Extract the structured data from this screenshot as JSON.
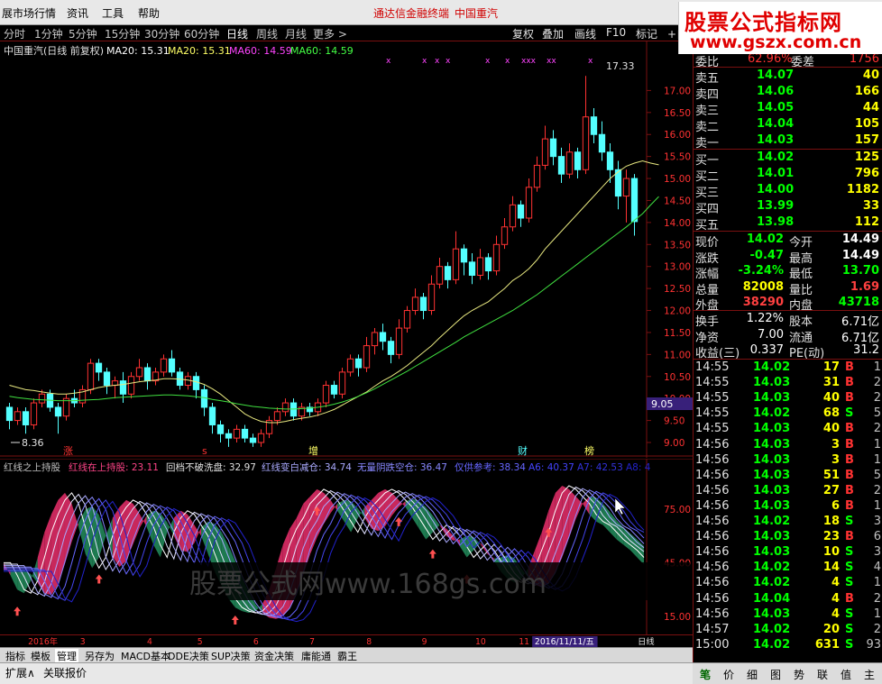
{
  "menubar": {
    "items": [
      "展市场行情",
      "资讯",
      "工具",
      "帮助"
    ],
    "center_title": "通达信金融终端",
    "center_stock": "中国重汽"
  },
  "logo": {
    "line1": "股票公式指标网",
    "line2": "www.gszx.com.cn"
  },
  "toolbar": {
    "periods": [
      "分时",
      "1分钟",
      "5分钟",
      "15分钟",
      "30分钟",
      "60分钟",
      "日线",
      "周线",
      "月线",
      "更多 >"
    ],
    "active_period": "日线",
    "right_buttons": [
      "复权",
      "叠加",
      "画线",
      "F10",
      "标记",
      "+自"
    ]
  },
  "main_chart": {
    "header_name": "中国重汽(日线 前复权)",
    "ma_items": [
      {
        "text": "MA20: 15.31",
        "color": "#ffffff"
      },
      {
        "text": "MA20: 15.31",
        "color": "#ffff66"
      },
      {
        "text": "MA60: 14.59",
        "color": "#ff44ff"
      },
      {
        "text": "MA60: 14.59",
        "color": "#44ff44"
      }
    ],
    "high_label": "17.33",
    "low_label": "8.36",
    "current_price_tag": "9.05",
    "event_marks": [
      "涨",
      "s",
      "增",
      "财",
      "榜"
    ],
    "x_marks": [
      "x",
      "x",
      "x",
      "x",
      "x",
      "x",
      "xxx",
      "xx",
      "x"
    ]
  },
  "chart_data": {
    "type": "candlestick",
    "y_ticks": [
      "17.00",
      "16.50",
      "16.00",
      "15.50",
      "15.00",
      "14.50",
      "14.00",
      "13.50",
      "13.00",
      "12.50",
      "12.00",
      "11.50",
      "11.00",
      "10.50",
      "10.00",
      "9.50",
      "9.00"
    ],
    "ylim": [
      9.0,
      17.5
    ],
    "candles": [
      {
        "o": 9.8,
        "c": 9.5,
        "h": 9.9,
        "l": 9.3
      },
      {
        "o": 9.5,
        "c": 9.7,
        "h": 9.8,
        "l": 9.4
      },
      {
        "o": 9.7,
        "c": 9.4,
        "h": 9.8,
        "l": 9.2
      },
      {
        "o": 9.4,
        "c": 9.9,
        "h": 10.0,
        "l": 9.3
      },
      {
        "o": 9.9,
        "c": 10.1,
        "h": 10.2,
        "l": 9.8
      },
      {
        "o": 10.1,
        "c": 9.8,
        "h": 10.2,
        "l": 9.7
      },
      {
        "o": 9.8,
        "c": 9.6,
        "h": 9.9,
        "l": 9.2
      },
      {
        "o": 9.6,
        "c": 10.0,
        "h": 10.1,
        "l": 9.5
      },
      {
        "o": 10.0,
        "c": 9.9,
        "h": 10.2,
        "l": 9.8
      },
      {
        "o": 9.9,
        "c": 10.2,
        "h": 10.3,
        "l": 9.8
      },
      {
        "o": 10.2,
        "c": 10.8,
        "h": 10.9,
        "l": 10.1
      },
      {
        "o": 10.8,
        "c": 10.6,
        "h": 10.9,
        "l": 10.4
      },
      {
        "o": 10.6,
        "c": 10.3,
        "h": 10.7,
        "l": 10.1
      },
      {
        "o": 10.3,
        "c": 10.4,
        "h": 10.5,
        "l": 10.0
      },
      {
        "o": 10.4,
        "c": 10.1,
        "h": 10.6,
        "l": 9.9
      },
      {
        "o": 10.1,
        "c": 10.5,
        "h": 10.6,
        "l": 10.0
      },
      {
        "o": 10.5,
        "c": 10.7,
        "h": 10.9,
        "l": 10.4
      },
      {
        "o": 10.7,
        "c": 10.4,
        "h": 10.8,
        "l": 10.2
      },
      {
        "o": 10.4,
        "c": 10.6,
        "h": 10.7,
        "l": 10.3
      },
      {
        "o": 10.6,
        "c": 10.9,
        "h": 11.0,
        "l": 10.5
      },
      {
        "o": 10.9,
        "c": 10.6,
        "h": 11.1,
        "l": 10.5
      },
      {
        "o": 10.6,
        "c": 10.3,
        "h": 10.7,
        "l": 10.2
      },
      {
        "o": 10.3,
        "c": 10.5,
        "h": 10.6,
        "l": 10.2
      },
      {
        "o": 10.5,
        "c": 10.2,
        "h": 10.6,
        "l": 10.0
      },
      {
        "o": 10.2,
        "c": 9.8,
        "h": 10.3,
        "l": 9.6
      },
      {
        "o": 9.8,
        "c": 9.4,
        "h": 9.9,
        "l": 9.2
      },
      {
        "o": 9.4,
        "c": 9.2,
        "h": 9.5,
        "l": 9.0
      },
      {
        "o": 9.2,
        "c": 9.1,
        "h": 9.3,
        "l": 8.9
      },
      {
        "o": 9.1,
        "c": 9.3,
        "h": 9.4,
        "l": 9.0
      },
      {
        "o": 9.3,
        "c": 9.1,
        "h": 9.4,
        "l": 9.0
      },
      {
        "o": 9.1,
        "c": 9.0,
        "h": 9.2,
        "l": 8.9
      },
      {
        "o": 9.0,
        "c": 9.2,
        "h": 9.3,
        "l": 8.9
      },
      {
        "o": 9.2,
        "c": 9.5,
        "h": 9.6,
        "l": 9.1
      },
      {
        "o": 9.5,
        "c": 9.7,
        "h": 9.8,
        "l": 9.4
      },
      {
        "o": 9.7,
        "c": 9.9,
        "h": 10.0,
        "l": 9.6
      },
      {
        "o": 9.9,
        "c": 9.6,
        "h": 10.0,
        "l": 9.5
      },
      {
        "o": 9.6,
        "c": 9.8,
        "h": 9.9,
        "l": 9.5
      },
      {
        "o": 9.8,
        "c": 9.7,
        "h": 9.9,
        "l": 9.6
      },
      {
        "o": 9.7,
        "c": 9.9,
        "h": 10.0,
        "l": 9.6
      },
      {
        "o": 9.9,
        "c": 10.3,
        "h": 10.4,
        "l": 9.8
      },
      {
        "o": 10.3,
        "c": 10.1,
        "h": 10.4,
        "l": 10.0
      },
      {
        "o": 10.1,
        "c": 10.6,
        "h": 10.7,
        "l": 10.0
      },
      {
        "o": 10.6,
        "c": 10.9,
        "h": 11.0,
        "l": 10.5
      },
      {
        "o": 10.9,
        "c": 10.7,
        "h": 11.0,
        "l": 10.5
      },
      {
        "o": 10.7,
        "c": 11.2,
        "h": 11.4,
        "l": 10.6
      },
      {
        "o": 11.2,
        "c": 11.5,
        "h": 11.6,
        "l": 11.0
      },
      {
        "o": 11.5,
        "c": 11.3,
        "h": 11.7,
        "l": 11.1
      },
      {
        "o": 11.3,
        "c": 11.0,
        "h": 11.4,
        "l": 10.8
      },
      {
        "o": 11.0,
        "c": 11.6,
        "h": 11.8,
        "l": 10.9
      },
      {
        "o": 11.6,
        "c": 12.0,
        "h": 12.1,
        "l": 11.5
      },
      {
        "o": 12.0,
        "c": 12.3,
        "h": 12.5,
        "l": 11.9
      },
      {
        "o": 12.3,
        "c": 12.0,
        "h": 12.4,
        "l": 11.8
      },
      {
        "o": 12.0,
        "c": 12.6,
        "h": 12.8,
        "l": 11.9
      },
      {
        "o": 12.6,
        "c": 13.0,
        "h": 13.2,
        "l": 12.5
      },
      {
        "o": 13.0,
        "c": 12.7,
        "h": 13.1,
        "l": 12.5
      },
      {
        "o": 12.7,
        "c": 13.4,
        "h": 13.8,
        "l": 12.6
      },
      {
        "o": 13.4,
        "c": 13.1,
        "h": 13.5,
        "l": 12.8
      },
      {
        "o": 13.1,
        "c": 12.8,
        "h": 13.3,
        "l": 12.6
      },
      {
        "o": 12.8,
        "c": 13.2,
        "h": 13.4,
        "l": 12.7
      },
      {
        "o": 13.2,
        "c": 12.9,
        "h": 13.3,
        "l": 12.7
      },
      {
        "o": 12.9,
        "c": 13.5,
        "h": 13.7,
        "l": 12.8
      },
      {
        "o": 13.5,
        "c": 13.9,
        "h": 14.1,
        "l": 13.4
      },
      {
        "o": 13.9,
        "c": 14.4,
        "h": 14.6,
        "l": 13.8
      },
      {
        "o": 14.4,
        "c": 14.1,
        "h": 14.5,
        "l": 13.9
      },
      {
        "o": 14.1,
        "c": 14.8,
        "h": 15.0,
        "l": 14.0
      },
      {
        "o": 14.8,
        "c": 15.3,
        "h": 15.5,
        "l": 14.7
      },
      {
        "o": 15.3,
        "c": 15.9,
        "h": 16.2,
        "l": 15.2
      },
      {
        "o": 15.9,
        "c": 15.5,
        "h": 16.1,
        "l": 15.3
      },
      {
        "o": 15.5,
        "c": 15.1,
        "h": 15.7,
        "l": 14.9
      },
      {
        "o": 15.1,
        "c": 15.6,
        "h": 15.8,
        "l": 15.0
      },
      {
        "o": 15.6,
        "c": 15.2,
        "h": 15.7,
        "l": 15.0
      },
      {
        "o": 15.2,
        "c": 16.4,
        "h": 17.33,
        "l": 15.1
      },
      {
        "o": 16.4,
        "c": 16.0,
        "h": 16.6,
        "l": 15.8
      },
      {
        "o": 16.0,
        "c": 15.6,
        "h": 16.3,
        "l": 15.4
      },
      {
        "o": 15.6,
        "c": 15.2,
        "h": 15.8,
        "l": 14.9
      },
      {
        "o": 15.2,
        "c": 14.6,
        "h": 15.4,
        "l": 14.3
      },
      {
        "o": 14.6,
        "c": 15.0,
        "h": 15.2,
        "l": 14.0
      },
      {
        "o": 15.0,
        "c": 14.02,
        "h": 15.1,
        "l": 13.7
      }
    ],
    "ma20": [
      10.3,
      10.25,
      10.2,
      10.18,
      10.15,
      10.12,
      10.1,
      10.1,
      10.12,
      10.15,
      10.2,
      10.25,
      10.28,
      10.3,
      10.32,
      10.35,
      10.38,
      10.4,
      10.42,
      10.45,
      10.45,
      10.44,
      10.42,
      10.38,
      10.32,
      10.22,
      10.1,
      9.95,
      9.8,
      9.65,
      9.55,
      9.48,
      9.45,
      9.45,
      9.48,
      9.52,
      9.55,
      9.58,
      9.62,
      9.68,
      9.75,
      9.85,
      9.95,
      10.05,
      10.15,
      10.28,
      10.4,
      10.5,
      10.62,
      10.75,
      10.9,
      11.05,
      11.2,
      11.38,
      11.55,
      11.72,
      11.88,
      12.0,
      12.1,
      12.2,
      12.35,
      12.5,
      12.68,
      12.8,
      12.95,
      13.15,
      13.4,
      13.6,
      13.8,
      14.0,
      14.2,
      14.4,
      14.6,
      14.8,
      15.0,
      15.15,
      15.28,
      15.35,
      15.4,
      15.35,
      15.31
    ],
    "ma60": [
      10.05,
      10.02,
      10.0,
      9.98,
      9.97,
      9.96,
      9.95,
      9.95,
      9.95,
      9.96,
      9.97,
      9.98,
      10.0,
      10.02,
      10.03,
      10.04,
      10.05,
      10.06,
      10.07,
      10.08,
      10.08,
      10.07,
      10.06,
      10.04,
      10.02,
      9.98,
      9.95,
      9.92,
      9.88,
      9.85,
      9.82,
      9.8,
      9.78,
      9.77,
      9.76,
      9.76,
      9.77,
      9.78,
      9.8,
      9.83,
      9.87,
      9.92,
      9.98,
      10.05,
      10.13,
      10.22,
      10.32,
      10.42,
      10.52,
      10.62,
      10.73,
      10.84,
      10.95,
      11.06,
      11.17,
      11.28,
      11.4,
      11.5,
      11.6,
      11.7,
      11.8,
      11.9,
      12.0,
      12.12,
      12.24,
      12.36,
      12.5,
      12.64,
      12.78,
      12.92,
      13.06,
      13.2,
      13.34,
      13.48,
      13.62,
      13.76,
      13.9,
      14.05,
      14.2,
      14.4,
      14.59
    ]
  },
  "indicator": {
    "header_items": [
      {
        "text": "红线之上持股",
        "color": "#c0c0c0"
      },
      {
        "text": "红线在上持股: 23.11",
        "color": "#ff4488"
      },
      {
        "text": "回档不破洗盘: 32.97",
        "color": "#e0e0e0"
      },
      {
        "text": "红线变白减仓: 34.74",
        "color": "#aaaaff"
      },
      {
        "text": "无量阴跌空仓: 36.47",
        "color": "#8888ff"
      },
      {
        "text": "仅供参考: 38.34",
        "color": "#6666ff"
      },
      {
        "text": "A6: 40.37",
        "color": "#4444ff"
      },
      {
        "text": "A7: 42.53",
        "color": "#3333dd"
      },
      {
        "text": "A8: 4",
        "color": "#2222cc"
      }
    ],
    "y_ticks": [
      "75.00",
      "45.00",
      "15.00"
    ],
    "values": [
      45,
      38,
      30,
      28,
      35,
      48,
      62,
      72,
      80,
      84,
      78,
      65,
      50,
      42,
      48,
      60,
      70,
      76,
      80,
      78,
      72,
      65,
      55,
      48,
      62,
      70,
      74,
      72,
      66,
      60,
      50,
      40,
      32,
      25,
      20,
      18,
      17,
      18,
      22,
      30,
      42,
      55,
      64,
      70,
      78,
      82,
      86,
      84,
      80,
      74,
      68,
      62,
      70,
      76,
      80,
      84,
      86,
      84,
      80,
      76,
      70,
      64,
      58,
      62,
      66,
      64,
      60,
      54,
      48,
      52,
      56,
      52,
      46,
      40,
      36,
      34,
      36,
      42,
      52,
      62,
      74,
      84,
      88,
      86,
      82,
      78,
      72,
      68,
      66,
      62,
      58,
      55,
      52,
      48,
      44
    ],
    "watermark": "股票公式网www.168gs.com"
  },
  "time_axis": {
    "labels": [
      "2016年",
      "3",
      "4",
      "5",
      "6",
      "7",
      "8",
      "9",
      "10",
      "11"
    ],
    "highlight": "2016/11/11/五",
    "right_label": "日线"
  },
  "tabs": {
    "items": [
      "指标",
      "模板",
      "管理",
      "另存为",
      "MACD基本",
      "DDE决策",
      "SUP决策",
      "资金决策",
      "庸能通",
      "霸王"
    ],
    "active": "管理"
  },
  "statusbar": {
    "left": "扩展∧",
    "right": "关联报价"
  },
  "quote_panel": {
    "top_partial": {
      "label": "委比",
      "value": "62.96%",
      "label2": "委差",
      "value2": "1756"
    },
    "sell": [
      {
        "label": "卖五",
        "price": "14.07",
        "vol": "40"
      },
      {
        "label": "卖四",
        "price": "14.06",
        "vol": "166"
      },
      {
        "label": "卖三",
        "price": "14.05",
        "vol": "44"
      },
      {
        "label": "卖二",
        "price": "14.04",
        "vol": "105"
      },
      {
        "label": "卖一",
        "price": "14.03",
        "vol": "157"
      }
    ],
    "buy": [
      {
        "label": "买一",
        "price": "14.02",
        "vol": "125"
      },
      {
        "label": "买二",
        "price": "14.01",
        "vol": "796"
      },
      {
        "label": "买三",
        "price": "14.00",
        "vol": "1182"
      },
      {
        "label": "买四",
        "price": "13.99",
        "vol": "33"
      },
      {
        "label": "买五",
        "price": "13.98",
        "vol": "112"
      }
    ],
    "stats": [
      {
        "l1": "现价",
        "v1": "14.02",
        "c1": "#00ff00",
        "l2": "今开",
        "v2": "14.49",
        "c2": "#ffffff"
      },
      {
        "l1": "涨跌",
        "v1": "-0.47",
        "c1": "#00ff00",
        "l2": "最高",
        "v2": "14.49",
        "c2": "#ffffff"
      },
      {
        "l1": "涨幅",
        "v1": "-3.24%",
        "c1": "#00ff00",
        "l2": "最低",
        "v2": "13.70",
        "c2": "#00ff00"
      },
      {
        "l1": "总量",
        "v1": "82008",
        "c1": "#ffff00",
        "l2": "量比",
        "v2": "1.69",
        "c2": "#ff4040"
      },
      {
        "l1": "外盘",
        "v1": "38290",
        "c1": "#ff4040",
        "l2": "内盘",
        "v2": "43718",
        "c2": "#00ff00"
      }
    ],
    "stats2": [
      {
        "l1": "换手",
        "v1": "1.22%",
        "c1": "#ffffff",
        "l2": "股本",
        "v2": "6.71亿",
        "c2": "#ffffff"
      },
      {
        "l1": "净资",
        "v1": "7.00",
        "c1": "#ffffff",
        "l2": "流通",
        "v2": "6.71亿",
        "c2": "#ffffff"
      },
      {
        "l1": "收益(三)",
        "v1": "0.337",
        "c1": "#ffffff",
        "l2": "PE(动)",
        "v2": "31.2",
        "c2": "#ffffff"
      }
    ],
    "ticks": [
      {
        "t": "14:55",
        "p": "14.02",
        "v": "17",
        "bs": "B",
        "n": "1"
      },
      {
        "t": "14:55",
        "p": "14.03",
        "v": "31",
        "bs": "B",
        "n": "2"
      },
      {
        "t": "14:55",
        "p": "14.03",
        "v": "40",
        "bs": "B",
        "n": "2"
      },
      {
        "t": "14:55",
        "p": "14.02",
        "v": "68",
        "bs": "S",
        "n": "5"
      },
      {
        "t": "14:55",
        "p": "14.03",
        "v": "40",
        "bs": "B",
        "n": "2"
      },
      {
        "t": "14:56",
        "p": "14.03",
        "v": "3",
        "bs": "B",
        "n": "1"
      },
      {
        "t": "14:56",
        "p": "14.03",
        "v": "3",
        "bs": "B",
        "n": "1"
      },
      {
        "t": "14:56",
        "p": "14.03",
        "v": "51",
        "bs": "B",
        "n": "5"
      },
      {
        "t": "14:56",
        "p": "14.03",
        "v": "27",
        "bs": "B",
        "n": "2"
      },
      {
        "t": "14:56",
        "p": "14.03",
        "v": "6",
        "bs": "B",
        "n": "1"
      },
      {
        "t": "14:56",
        "p": "14.02",
        "v": "18",
        "bs": "S",
        "n": "3"
      },
      {
        "t": "14:56",
        "p": "14.03",
        "v": "23",
        "bs": "B",
        "n": "6"
      },
      {
        "t": "14:56",
        "p": "14.03",
        "v": "10",
        "bs": "S",
        "n": "3"
      },
      {
        "t": "14:56",
        "p": "14.02",
        "v": "14",
        "bs": "S",
        "n": "4"
      },
      {
        "t": "14:56",
        "p": "14.02",
        "v": "4",
        "bs": "S",
        "n": "1"
      },
      {
        "t": "14:56",
        "p": "14.04",
        "v": "4",
        "bs": "B",
        "n": "2"
      },
      {
        "t": "14:56",
        "p": "14.03",
        "v": "4",
        "bs": "S",
        "n": "1"
      },
      {
        "t": "14:57",
        "p": "14.02",
        "v": "20",
        "bs": "S",
        "n": "2"
      },
      {
        "t": "15:00",
        "p": "14.02",
        "v": "631",
        "bs": "S",
        "n": "93"
      }
    ]
  },
  "bottom_tabs": {
    "items": [
      "笔",
      "价",
      "细",
      "图",
      "势",
      "联",
      "值",
      "主"
    ],
    "active": "笔"
  },
  "colors": {
    "up": "#ff3232",
    "down": "#54ffff",
    "grid": "#7a1010",
    "ma20": "#e8e880",
    "ma60": "#40e040",
    "sell": "#00ff00",
    "buy_s": "#00ff00",
    "buy_b": "#ff3232"
  }
}
